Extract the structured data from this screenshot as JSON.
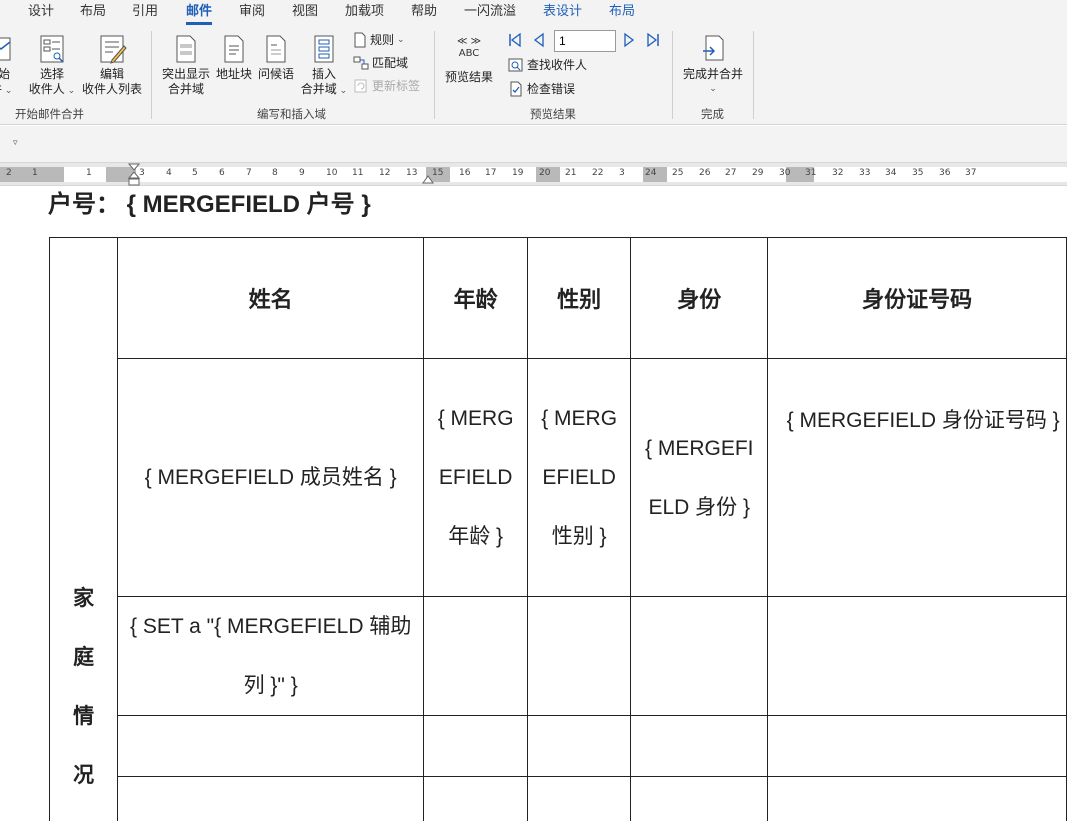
{
  "tabs": [
    "设计",
    "布局",
    "引用",
    "邮件",
    "审阅",
    "视图",
    "加载项",
    "帮助",
    "一闪流溢",
    "表设计",
    "布局"
  ],
  "active_tab": "邮件",
  "ribbon": {
    "start_group": {
      "label": "开始邮件合并",
      "start_merge_partial": [
        "始",
        "并"
      ],
      "select_recipients": [
        "选择",
        "收件人"
      ],
      "edit_recipients": [
        "编辑",
        "收件人列表"
      ]
    },
    "write_group": {
      "label": "编写和插入域",
      "highlight_fields": [
        "突出显示",
        "合并域"
      ],
      "address_block": "地址块",
      "greeting_line": "问候语",
      "insert_field": [
        "插入",
        "合并域"
      ],
      "rules": "规则",
      "match_fields": "匹配域",
      "update_labels": "更新标签"
    },
    "preview_group": {
      "label": "预览结果",
      "preview_results": "预览结果",
      "abc_icon_text": "ABC",
      "record_number": "1",
      "find_recipient": "查找收件人",
      "check_errors": "检查错误"
    },
    "finish_group": {
      "label": "完成",
      "finish_merge": "完成并合并"
    }
  },
  "ruler": {
    "left_numbers": [
      "2",
      "1",
      "1"
    ],
    "numbers": [
      "3",
      "4",
      "5",
      "6",
      "7",
      "8",
      "9",
      "10",
      "11",
      "12",
      "13",
      "15",
      "16",
      "17",
      "19",
      "20",
      "21",
      "22",
      "3",
      "24",
      "25",
      "26",
      "27",
      "29",
      "30",
      "31",
      "32",
      "33",
      "34",
      "35",
      "36",
      "37"
    ]
  },
  "document": {
    "heading": "户号： { MERGEFIELD 户号 }",
    "side_label_chars": [
      "家",
      "庭",
      "情",
      "况"
    ],
    "headers": [
      "姓名",
      "年龄",
      "性别",
      "身份",
      "身份证号码"
    ],
    "row1": {
      "name": "{ MERGEFIELD 成员姓名 }",
      "age": "{ MERGEFIELD 年龄 }",
      "gender": "{ MERGEFIELD 性别 }",
      "identity": "{ MERGEFIELD 身份 }",
      "id_number": "{ MERGEFIELD 身份证号码 }"
    },
    "row2": {
      "name": "{ SET a \"{ MERGEFIELD 辅助列 }\" }"
    }
  },
  "colors": {
    "accent": "#1f5fb8",
    "ribbon_bg": "#f3f3f3",
    "ruler_bg": "#e7e7e7"
  }
}
